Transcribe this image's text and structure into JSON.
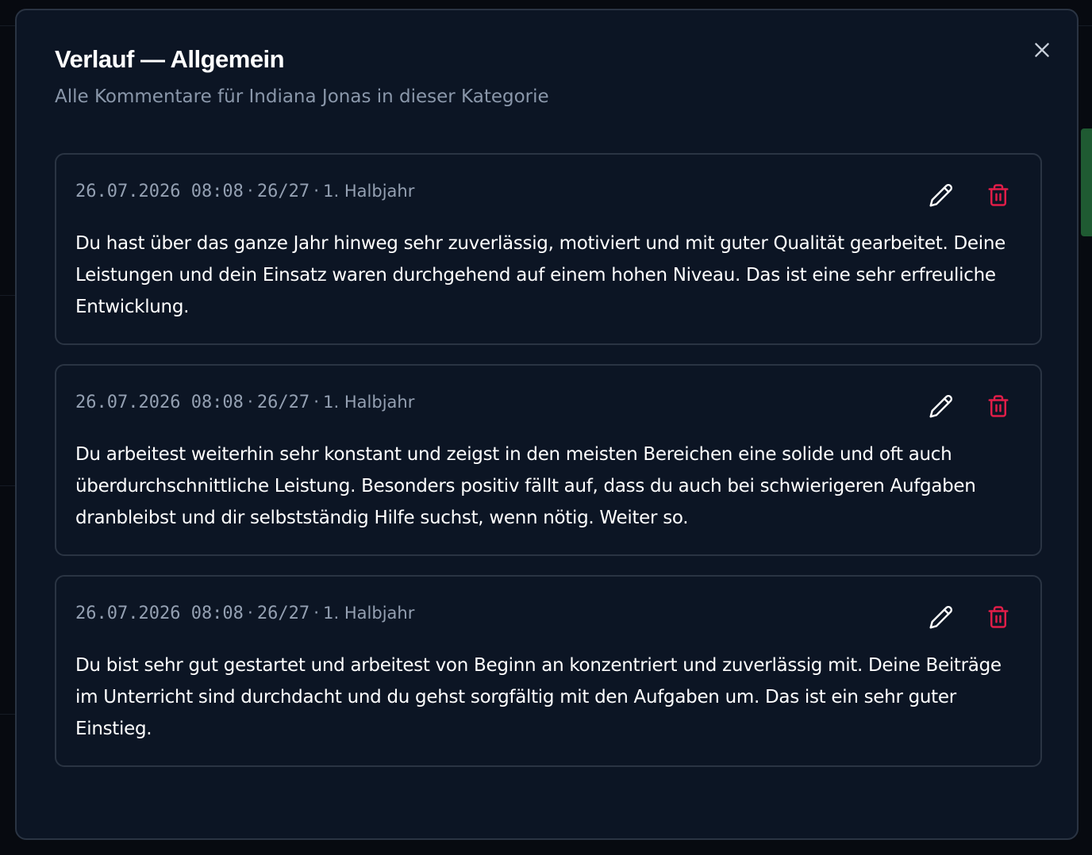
{
  "dialog": {
    "title": "Verlauf — Allgemein",
    "subtitle": "Alle Kommentare für Indiana Jonas in dieser Kategorie"
  },
  "entries": [
    {
      "datetime": "26.07.2026 08:08",
      "school_year": "26/27",
      "period": "1. Halbjahr",
      "text": "Du hast über das ganze Jahr hinweg sehr zuverlässig, motiviert und mit guter Qualität gearbeitet. Deine Leistungen und dein Einsatz waren durchgehend auf einem hohen Niveau. Das ist eine sehr erfreuliche Entwicklung."
    },
    {
      "datetime": "26.07.2026 08:08",
      "school_year": "26/27",
      "period": "1. Halbjahr",
      "text": "Du arbeitest weiterhin sehr konstant und zeigst in den meisten Bereichen eine solide und oft auch überdurchschnittliche Leistung. Besonders positiv fällt auf, dass du auch bei schwierigeren Aufgaben dranbleibst und dir selbstständig Hilfe suchst, wenn nötig. Weiter so."
    },
    {
      "datetime": "26.07.2026 08:08",
      "school_year": "26/27",
      "period": "1. Halbjahr",
      "text": "Du bist sehr gut gestartet und arbeitest von Beginn an konzentriert und zuverlässig mit. Deine Beiträge im Unterricht sind durchdacht und du gehst sorgfältig mit den Aufgaben um. Das ist ein sehr guter Einstieg."
    }
  ],
  "icons": {
    "close": "close-icon",
    "edit": "pencil-icon",
    "delete": "trash-icon"
  },
  "colors": {
    "background": "#0c1524",
    "border": "#2a3443",
    "text": "#ffffff",
    "muted": "#8a97aa",
    "delete": "#e11d48"
  }
}
